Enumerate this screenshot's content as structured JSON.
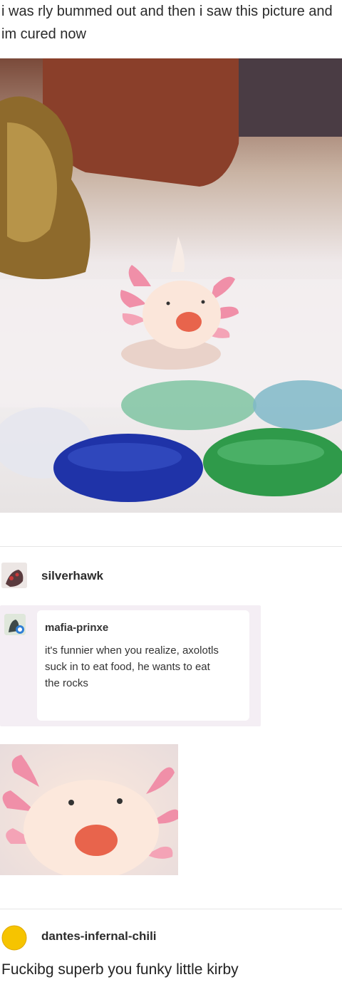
{
  "post": {
    "caption": "i was rly bummed out and then i saw this picture and im cured now"
  },
  "reblog_1": {
    "username": "silverhawk"
  },
  "reblog_2": {
    "username": "mafia-prinxe",
    "text": "it's funnier when you realize, axolotls suck in to eat food, he wants to eat the rocks"
  },
  "reblog_3": {
    "username": "dantes-infernal-chili",
    "text": "Fuckibg superb you funky little kirby"
  },
  "colors": {
    "axolotl_pink": "#f08fa8",
    "rock_blue": "#1f33a8",
    "rock_green": "#2f9a4a",
    "avatar_yellow": "#f6c400"
  }
}
